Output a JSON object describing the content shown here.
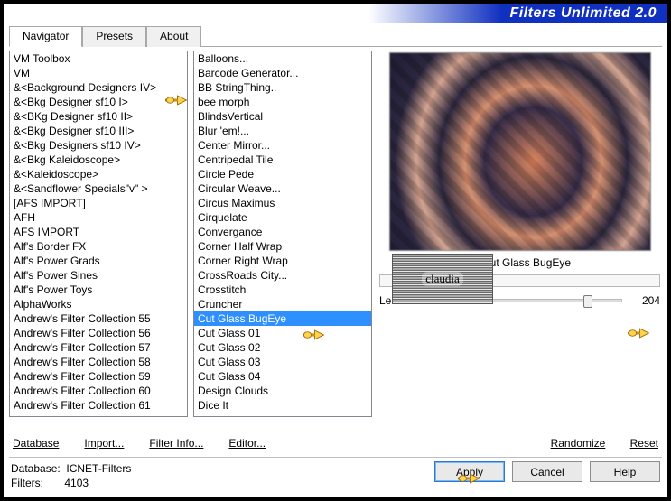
{
  "banner": {
    "title": "Filters Unlimited 2.0"
  },
  "tabs": [
    "Navigator",
    "Presets",
    "About"
  ],
  "active_tab": 0,
  "categories": {
    "selected_index": 3,
    "items": [
      "VM Toolbox",
      "VM",
      "&<Background Designers IV>",
      "&<Bkg Designer sf10 I>",
      "&<BKg Designer sf10 II>",
      "&<Bkg Designer sf10 III>",
      "&<Bkg Designers sf10 IV>",
      "&<Bkg Kaleidoscope>",
      "&<Kaleidoscope>",
      "&<Sandflower Specials\"v\" >",
      "[AFS IMPORT]",
      "AFH",
      "AFS IMPORT",
      "Alf's Border FX",
      "Alf's Power Grads",
      "Alf's Power Sines",
      "Alf's Power Toys",
      "AlphaWorks",
      "Andrew's Filter Collection 55",
      "Andrew's Filter Collection 56",
      "Andrew's Filter Collection 57",
      "Andrew's Filter Collection 58",
      "Andrew's Filter Collection 59",
      "Andrew's Filter Collection 60",
      "Andrew's Filter Collection 61"
    ]
  },
  "filters": {
    "selected_index": 16,
    "items": [
      "Balloons...",
      "Barcode Generator...",
      "BB StringThing..",
      "bee morph",
      "BlindsVertical",
      "Blur 'em!...",
      "Center Mirror...",
      "Centripedal Tile",
      "Circle Pede",
      "Circular Weave...",
      "Circus Maximus",
      "Cirquelate",
      "Convergance",
      "Corner Half Wrap",
      "Corner Right Wrap",
      "CrossRoads City...",
      "Crosstitch",
      "Cruncher",
      "Cut Glass  BugEye",
      "Cut Glass 01",
      "Cut Glass 02",
      "Cut Glass 03",
      "Cut Glass 04",
      "Design Clouds",
      "Dice It"
    ]
  },
  "current_filter_name": "Cut Glass  BugEye",
  "params": [
    {
      "label": "Lenses",
      "value": 204,
      "min": 0,
      "max": 255
    }
  ],
  "buttons": {
    "database": "Database",
    "import": "Import...",
    "filter_info": "Filter Info...",
    "editor": "Editor...",
    "randomize": "Randomize",
    "reset": "Reset",
    "apply": "Apply",
    "cancel": "Cancel",
    "help": "Help"
  },
  "footer": {
    "db_label": "Database:",
    "db_value": "ICNET-Filters",
    "filters_label": "Filters:",
    "filters_value": "4103"
  },
  "watermark": "claudia",
  "icons": {
    "hand": "pointing-hand-icon"
  }
}
